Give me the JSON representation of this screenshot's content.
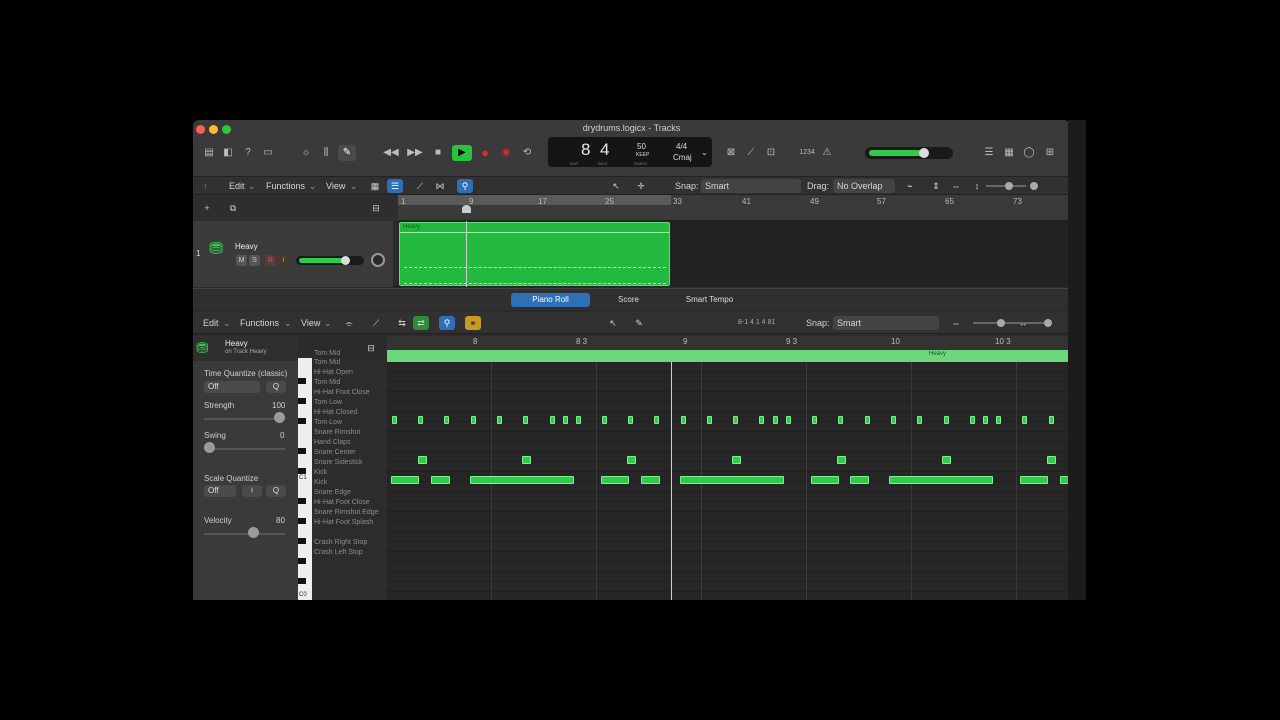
{
  "window_title": "drydrums.logicx - Tracks",
  "lcd": {
    "bar": "8",
    "beat": "4",
    "bar_label": "BAR",
    "beat_label": "BEAT",
    "tempo": "50",
    "tempo_label": "KEEP",
    "tempo_sub": "TEMPO",
    "sig": "4/4",
    "key": "Cmaj",
    "count_in": "1234"
  },
  "tracks_toolbar": {
    "edit": "Edit",
    "functions": "Functions",
    "view": "View",
    "snap_label": "Snap:",
    "snap_value": "Smart",
    "drag_label": "Drag:",
    "drag_value": "No Overlap"
  },
  "ruler": [
    "1",
    "9",
    "17",
    "25",
    "33",
    "41",
    "49",
    "57",
    "65",
    "73"
  ],
  "track": {
    "number": "1",
    "name": "Heavy",
    "mute": "M",
    "solo": "S",
    "rec": "R",
    "input": "I",
    "region_name": "Heavy"
  },
  "view_tabs": [
    "Piano Roll",
    "Score",
    "Smart Tempo"
  ],
  "piano_toolbar": {
    "edit": "Edit",
    "functions": "Functions",
    "view": "View",
    "position": "8-1 4 1 4 81",
    "snap_label": "Snap:",
    "snap_value": "Smart"
  },
  "inspector": {
    "region_name": "Heavy",
    "region_sub": "on Track Heavy",
    "time_quantize_label": "Time Quantize (classic)",
    "time_quantize_value": "Off",
    "q": "Q",
    "strength_label": "Strength",
    "strength_value": "100",
    "strength_level": 1.0,
    "swing_label": "Swing",
    "swing_value": "0",
    "swing_level": 0.0,
    "scale_quantize_label": "Scale Quantize",
    "scale_quantize_value": "Off",
    "velocity_label": "Velocity",
    "velocity_value": "80",
    "velocity_level": 0.6
  },
  "piano_ruler": [
    "8",
    "8 3",
    "9",
    "9 3",
    "10",
    "10 3"
  ],
  "piano_strip_label": "Heavy",
  "key_labels": {
    "c1": "C1",
    "c0": "C0"
  },
  "drum_names": [
    "Tom Mid",
    "Hi-Hat Open",
    "Tom Mid",
    "Hi-Hat Foot Close",
    "Tom Low",
    "Hi-Hat Closed",
    "Tom Low",
    "Snare Rimshot",
    "Hand Claps",
    "Snare Center",
    "Snare Sidestick",
    "Kick",
    "Kick",
    "Snare Edge",
    "Hi-Hat Foot Close",
    "Snare Rimshot Edge",
    "Hi-Hat Foot Splash",
    "",
    "Crash Right Stop",
    "Crash Left Stop"
  ],
  "colors": {
    "region": "#23b93f",
    "note": "#2fcb4a",
    "accent": "#2f6fb8"
  }
}
